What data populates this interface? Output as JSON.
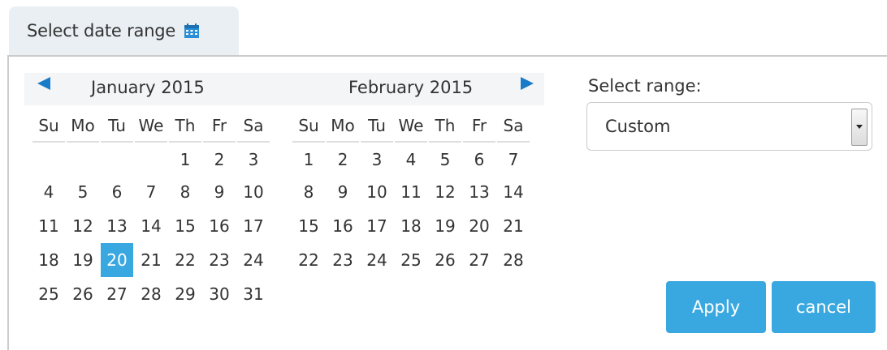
{
  "trigger": {
    "label": "Select date range",
    "icon": "calendar-icon"
  },
  "calendar": {
    "prev_icon": "triangle-left-icon",
    "next_icon": "triangle-right-icon",
    "weekdays": [
      "Su",
      "Mo",
      "Tu",
      "We",
      "Th",
      "Fr",
      "Sa"
    ],
    "months": [
      {
        "title": "January 2015",
        "weeks": [
          [
            "",
            "",
            "",
            "",
            "1",
            "2",
            "3"
          ],
          [
            "4",
            "5",
            "6",
            "7",
            "8",
            "9",
            "10"
          ],
          [
            "11",
            "12",
            "13",
            "14",
            "15",
            "16",
            "17"
          ],
          [
            "18",
            "19",
            "20",
            "21",
            "22",
            "23",
            "24"
          ],
          [
            "25",
            "26",
            "27",
            "28",
            "29",
            "30",
            "31"
          ]
        ],
        "selected_day": "20"
      },
      {
        "title": "February 2015",
        "weeks": [
          [
            "1",
            "2",
            "3",
            "4",
            "5",
            "6",
            "7"
          ],
          [
            "8",
            "9",
            "10",
            "11",
            "12",
            "13",
            "14"
          ],
          [
            "15",
            "16",
            "17",
            "18",
            "19",
            "20",
            "21"
          ],
          [
            "22",
            "23",
            "24",
            "25",
            "26",
            "27",
            "28"
          ]
        ],
        "selected_day": ""
      }
    ]
  },
  "range": {
    "label": "Select range:",
    "value": "Custom"
  },
  "buttons": {
    "apply": "Apply",
    "cancel": "cancel"
  },
  "colors": {
    "accent": "#3aa8e0",
    "nav_arrow": "#1a7bc6",
    "trigger_bg": "#e9eff3"
  }
}
